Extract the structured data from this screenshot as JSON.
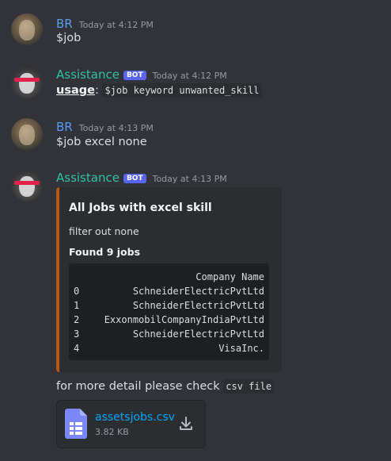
{
  "messages": [
    {
      "user": "BR",
      "time": "Today at 4:12 PM",
      "text": "$job"
    },
    {
      "user": "Assistance",
      "bot_tag": "BOT",
      "time": "Today at 4:12 PM",
      "usage_label": "usage",
      "usage_sep": ": ",
      "usage_code": "$job keyword unwanted_skill"
    },
    {
      "user": "BR",
      "time": "Today at 4:13 PM",
      "text": "$job excel none"
    },
    {
      "user": "Assistance",
      "bot_tag": "BOT",
      "time": "Today at 4:13 PM"
    }
  ],
  "embed": {
    "accent_color": "#b55a15",
    "title": "All Jobs with excel skill",
    "description": "filter out none",
    "field": "Found 9 jobs",
    "table_header": "Company Name",
    "rows": [
      {
        "idx": "0",
        "name": "SchneiderElectricPvtLtd"
      },
      {
        "idx": "1",
        "name": "SchneiderElectricPvtLtd"
      },
      {
        "idx": "2",
        "name": "ExxonmobilCompanyIndiaPvtLtd"
      },
      {
        "idx": "3",
        "name": "SchneiderElectricPvtLtd"
      },
      {
        "idx": "4",
        "name": "VisaInc."
      }
    ]
  },
  "followup": {
    "text": "for more detail please check ",
    "code": "csv file"
  },
  "attachment": {
    "filename": "assetsjobs.csv",
    "size": "3.82 KB",
    "icon": "document-icon",
    "action_icon": "download-icon"
  },
  "colors": {
    "background": "#313338",
    "user_br": "#5b9bf0",
    "user_bot": "#2fc2a5",
    "bot_tag": "#5865f2",
    "link": "#00a8fc"
  }
}
